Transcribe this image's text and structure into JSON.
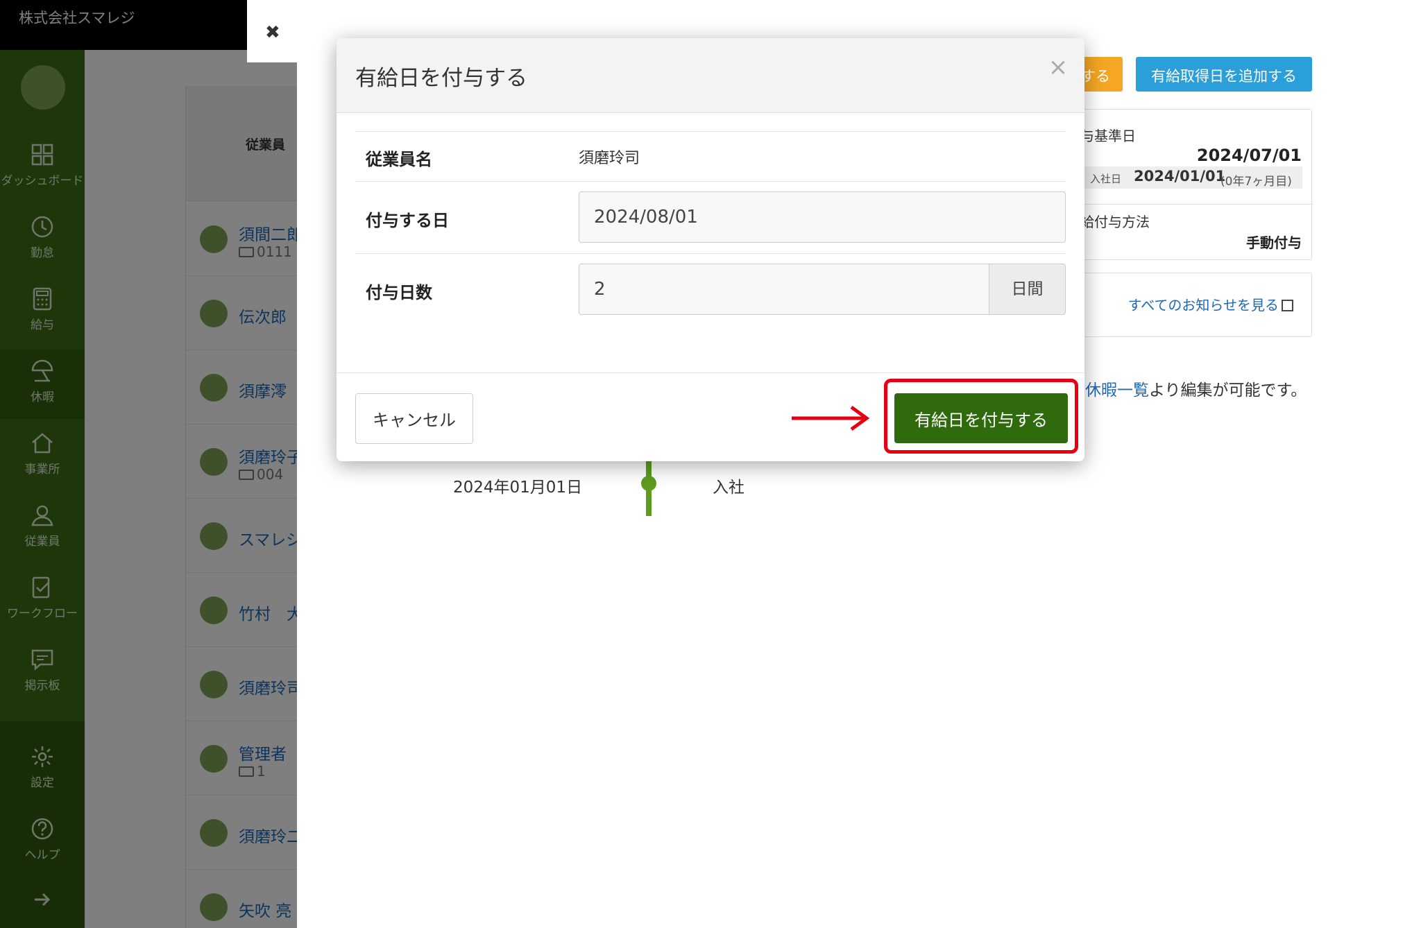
{
  "app": {
    "company": "株式会社スマレジ"
  },
  "sidebar": {
    "items": [
      {
        "label": "ダッシュボード",
        "icon": "dashboard-icon"
      },
      {
        "label": "勤怠",
        "icon": "clock-icon"
      },
      {
        "label": "給与",
        "icon": "calculator-icon"
      },
      {
        "label": "休暇",
        "icon": "umbrella-icon",
        "active": true
      },
      {
        "label": "事業所",
        "icon": "home-icon"
      },
      {
        "label": "従業員",
        "icon": "person-icon"
      },
      {
        "label": "ワークフロー",
        "icon": "workflow-icon"
      },
      {
        "label": "掲示板",
        "icon": "chat-icon"
      },
      {
        "label": "設定",
        "icon": "gear-icon"
      },
      {
        "label": "ヘルプ",
        "icon": "help-icon"
      }
    ],
    "expand_icon": "arrow-right-icon"
  },
  "employee_list": {
    "header": "従業員",
    "rows": [
      {
        "name": "須間二郎",
        "code": "0111"
      },
      {
        "name": "伝次郎",
        "code": ""
      },
      {
        "name": "須摩澪",
        "code": ""
      },
      {
        "name": "須磨玲子",
        "code": "004"
      },
      {
        "name": "スマレジ",
        "code": ""
      },
      {
        "name": "竹村　大",
        "code": ""
      },
      {
        "name": "須磨玲司",
        "code": ""
      },
      {
        "name": "管理者",
        "code": "1"
      },
      {
        "name": "須磨玲二",
        "code": ""
      },
      {
        "name": "矢吹 亮",
        "code": ""
      }
    ]
  },
  "detail": {
    "orange_button": "する",
    "add_leave_button": "有給取得日を追加する",
    "grant_base_label": "与基準日",
    "grant_base_date": "2024/07/01",
    "hire_label": "入社日",
    "hire_date": "2024/01/01",
    "tenure": "(0年7ヶ月目)",
    "method_label": "給付与方法",
    "method_value": "手動付与",
    "notice_link": "すべてのお知らせを見る",
    "hint_link": "休暇一覧",
    "hint_text": "より編集が可能です。",
    "timeline": {
      "date": "2024年01月01日",
      "event": "入社"
    }
  },
  "modal": {
    "title": "有給日を付与する",
    "close": "×",
    "employee_label": "従業員名",
    "employee_name": "須磨玲司",
    "grant_date_label": "付与する日",
    "grant_date_value": "2024/08/01",
    "grant_days_label": "付与日数",
    "grant_days_value": "2",
    "grant_days_unit": "日間",
    "cancel": "キャンセル",
    "submit": "有給日を付与する"
  },
  "colors": {
    "sidebar": "#3b6d14",
    "primary": "#2f6a0d",
    "orange": "#f5a623",
    "blue": "#2b9fd9",
    "highlight": "#e60012"
  }
}
